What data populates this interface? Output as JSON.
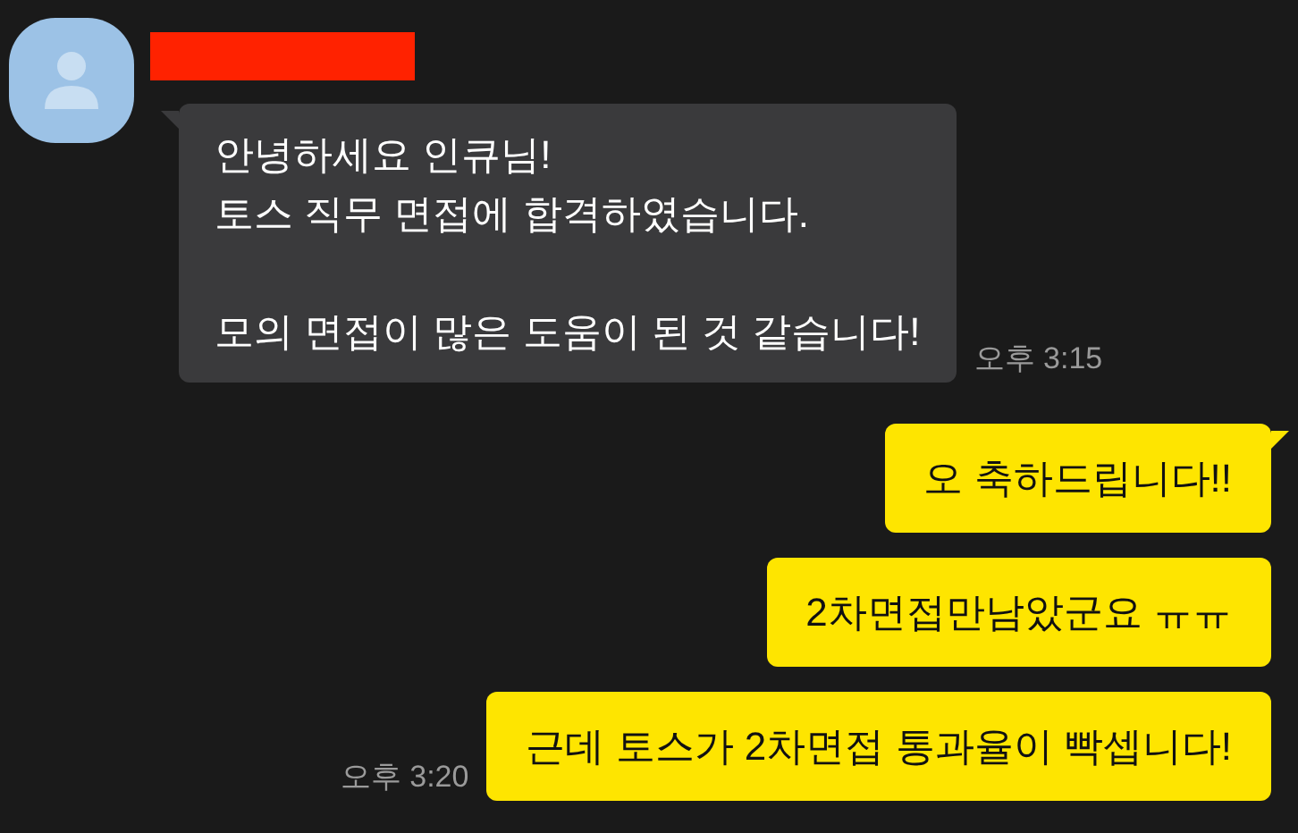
{
  "messages": [
    {
      "kind": "received",
      "text": "안녕하세요 인큐님!\n토스 직무 면접에 합격하였습니다.\n\n모의 면접이 많은 도움이 된 것 같습니다!",
      "time": "오후 3:15",
      "tail": true
    },
    {
      "kind": "sent",
      "text": "오 축하드립니다!!",
      "tail": true
    },
    {
      "kind": "sent",
      "text": "2차면접만남았군요 ㅠㅠ",
      "tail": false
    },
    {
      "kind": "sent",
      "text": "근데 토스가 2차면접 통과율이 빡셉니다!",
      "time": "오후 3:20",
      "tail": false
    }
  ]
}
